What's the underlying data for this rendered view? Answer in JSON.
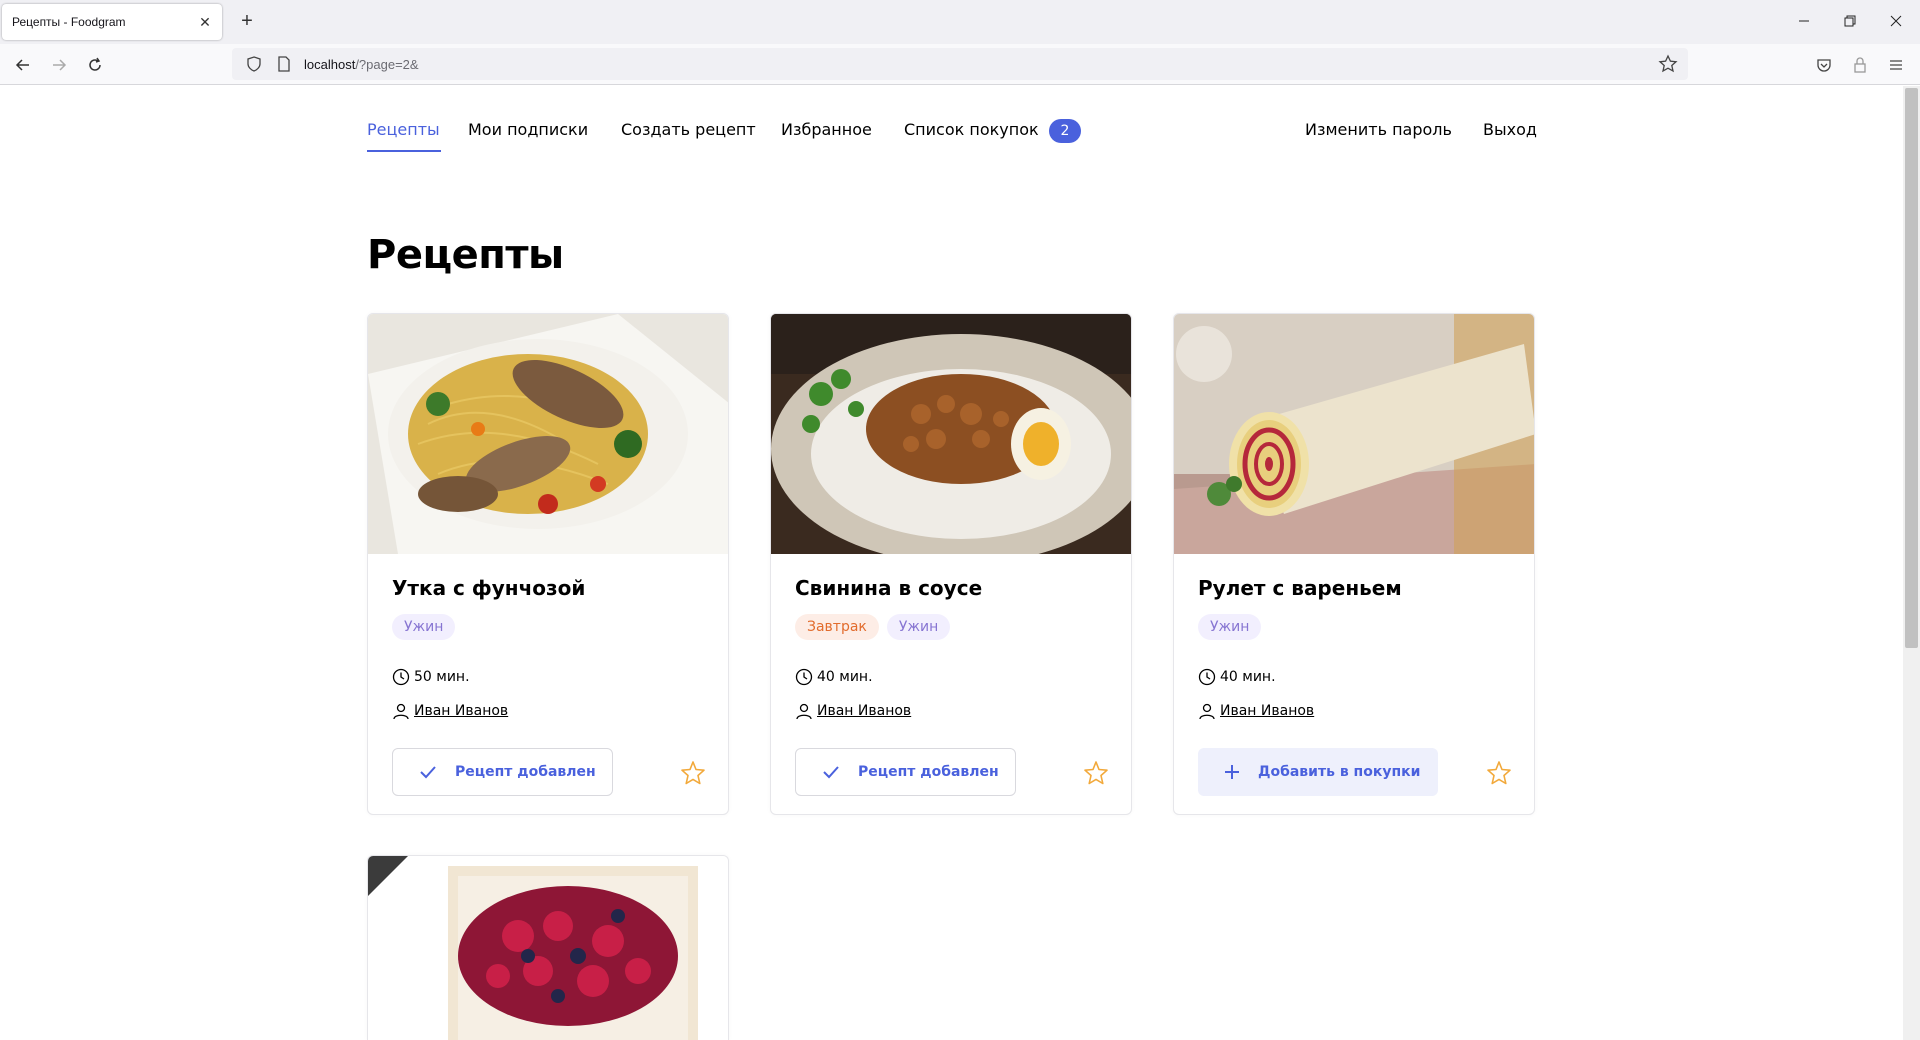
{
  "browser": {
    "tab_title": "Рецепты - Foodgram",
    "url_host": "localhost",
    "url_path": "/?page=2&"
  },
  "nav": {
    "items": [
      "Рецепты",
      "Мои подписки",
      "Создать рецепт",
      "Избранное",
      "Список покупок"
    ],
    "cart_count": "2",
    "change_password": "Изменить пароль",
    "logout": "Выход"
  },
  "page": {
    "title": "Рецепты"
  },
  "cards": [
    {
      "title": "Утка с фунчозой",
      "tags": [
        "Ужин"
      ],
      "time": "50 мин.",
      "author": "Иван Иванов",
      "button": "Рецепт добавлен"
    },
    {
      "title": "Свинина в соусе",
      "tags": [
        "Завтрак",
        "Ужин"
      ],
      "time": "40 мин.",
      "author": "Иван Иванов",
      "button": "Рецепт добавлен"
    },
    {
      "title": "Рулет с вареньем",
      "tags": [
        "Ужин"
      ],
      "time": "40 мин.",
      "author": "Иван Иванов",
      "button": "Добавить в покупки"
    }
  ],
  "colors": {
    "accent": "#4a61dd",
    "star": "#f2a93b",
    "dinner_tag": "#8775d2",
    "breakfast_tag": "#e26c2d"
  }
}
